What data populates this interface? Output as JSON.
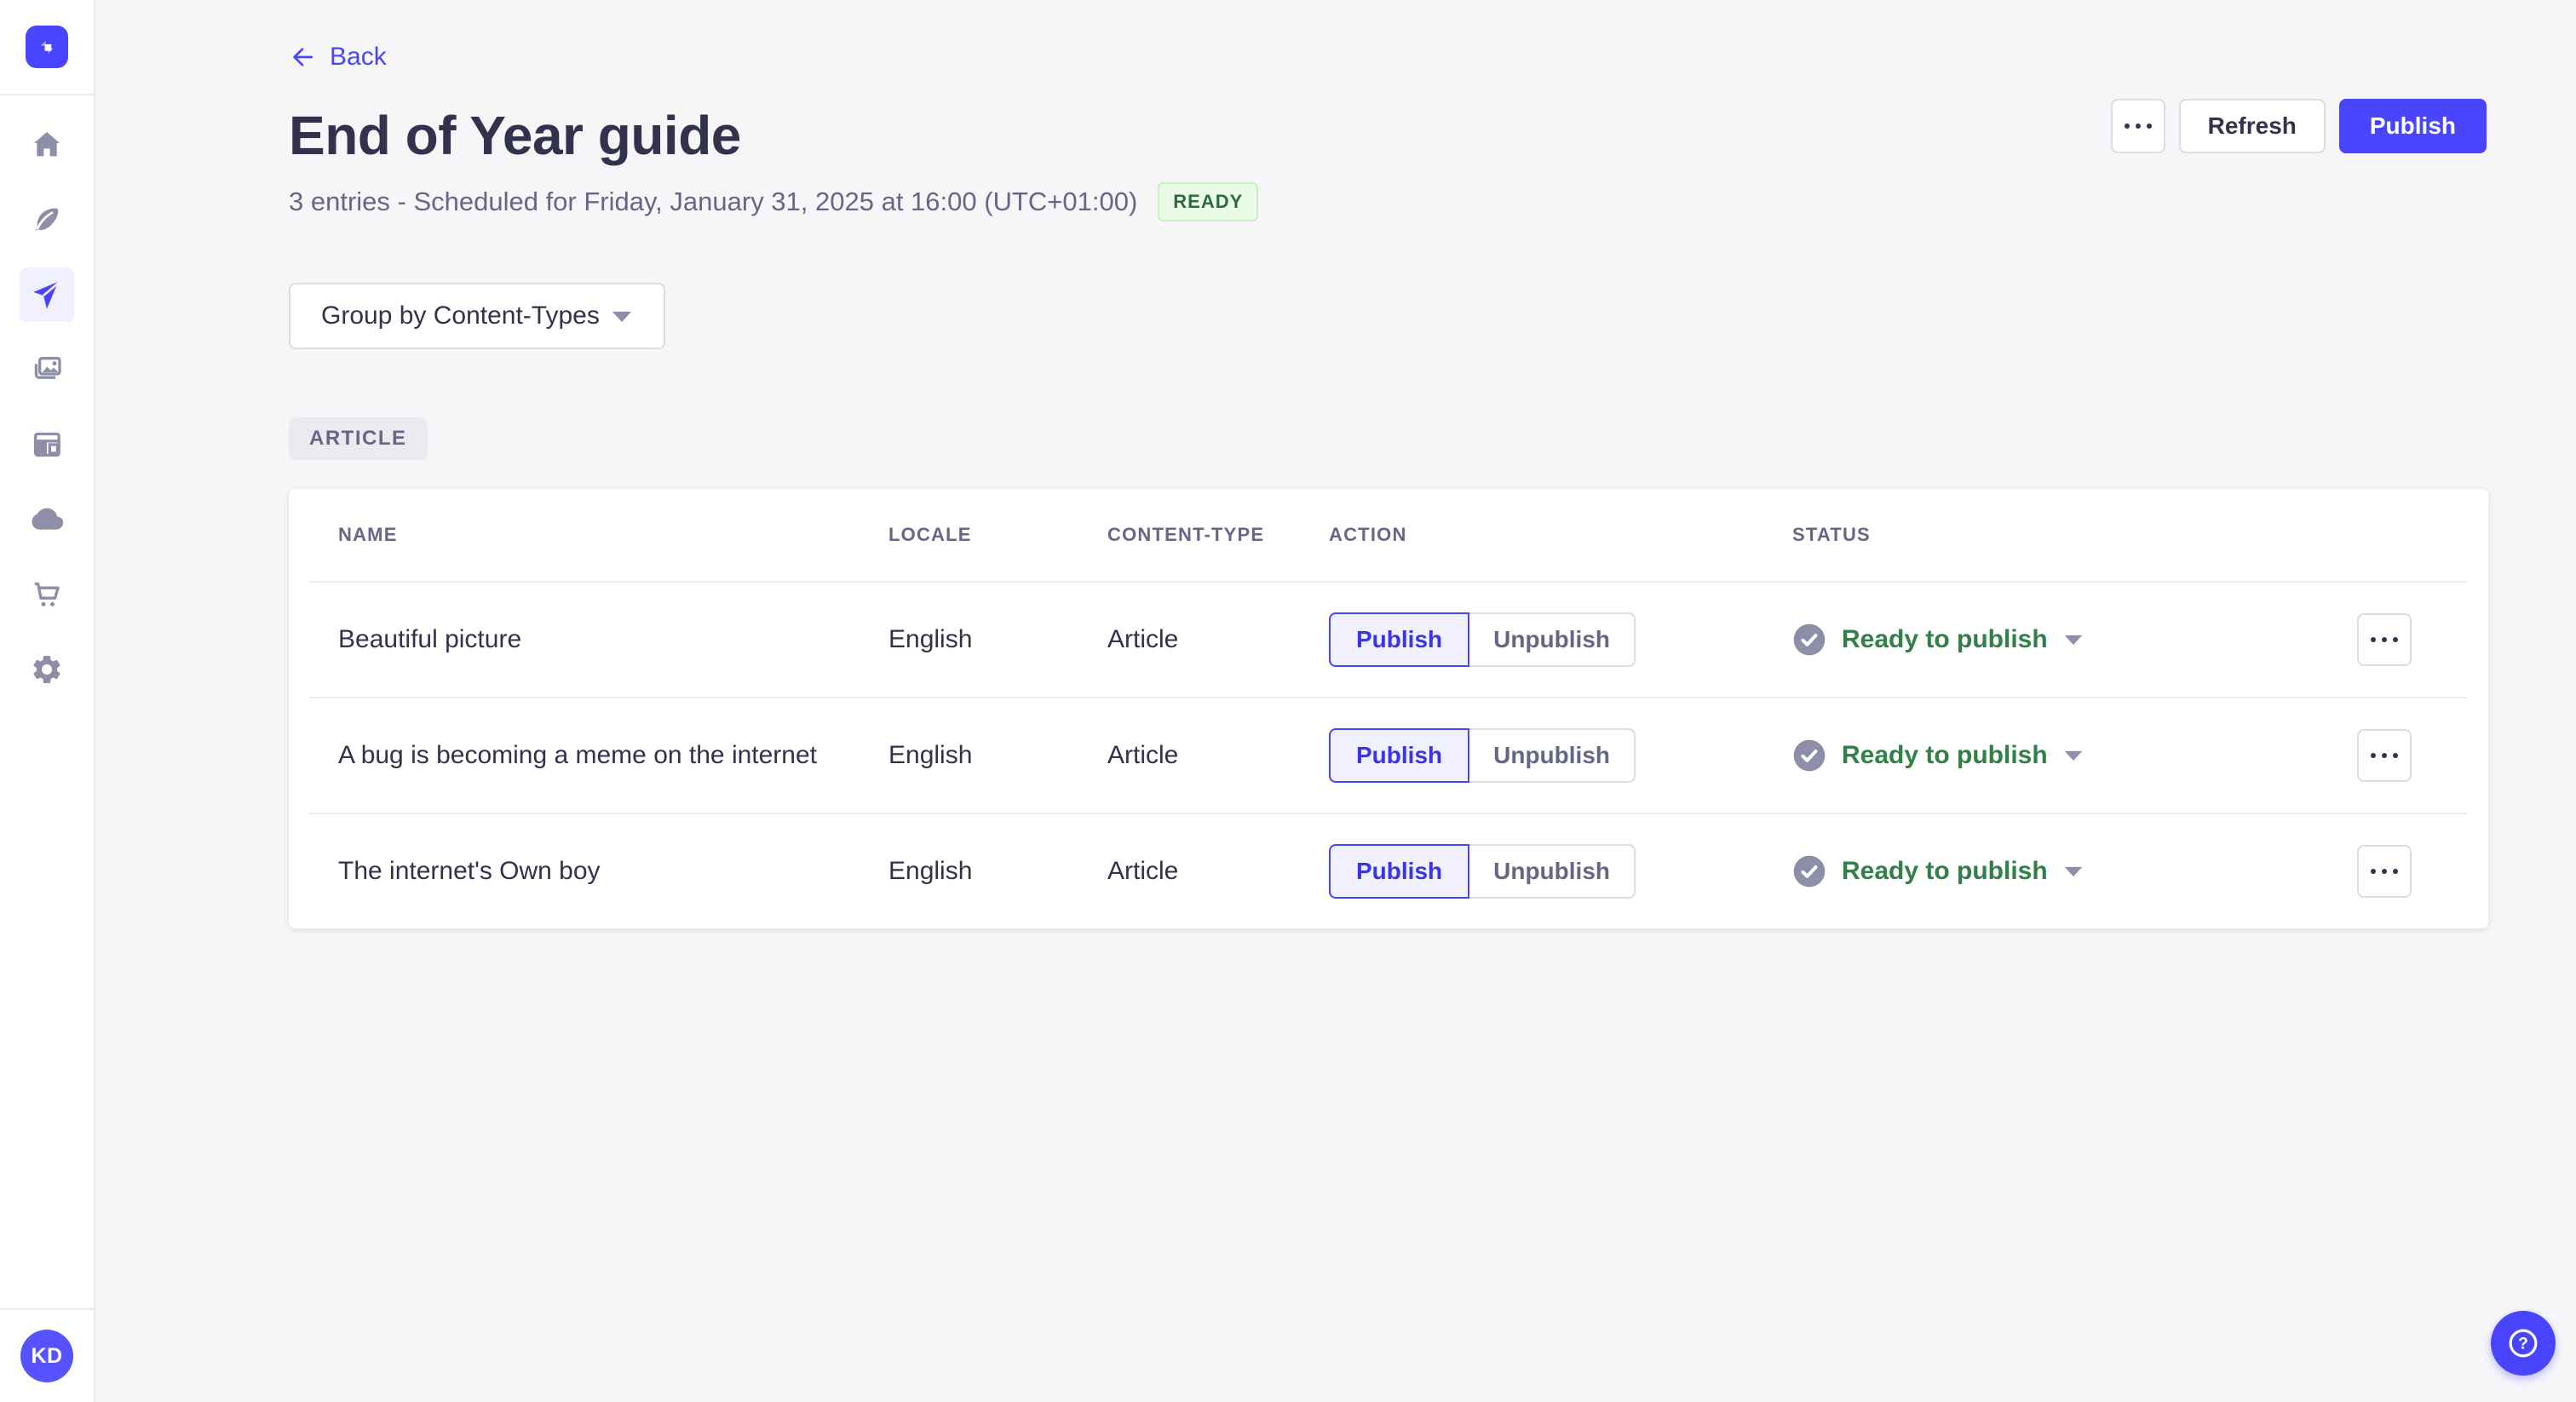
{
  "colors": {
    "primary": "#4945ff",
    "primary_bg": "#f0f0ff",
    "page_bg": "#f6f6f9",
    "text_dark": "#32324d",
    "text_muted": "#666687",
    "border": "#dcdce4",
    "divider": "#eaeaef",
    "success_text": "#2f6846",
    "success_bg": "#eafbe7",
    "status_green": "#328048",
    "icon_gray": "#8e8ea9"
  },
  "sidebar": {
    "logo_icon": "strapi-logo",
    "items": [
      {
        "icon": "home-icon",
        "active": false
      },
      {
        "icon": "feather-icon",
        "active": false
      },
      {
        "icon": "paper-plane-icon",
        "active": true
      },
      {
        "icon": "media-library-icon",
        "active": false
      },
      {
        "icon": "layout-icon",
        "active": false
      },
      {
        "icon": "cloud-icon",
        "active": false
      },
      {
        "icon": "cart-icon",
        "active": false
      },
      {
        "icon": "gear-icon",
        "active": false
      }
    ],
    "avatar_initials": "KD"
  },
  "header": {
    "back_label": "Back",
    "title": "End of Year guide",
    "subtitle": "3 entries - Scheduled for Friday, January 31, 2025 at 16:00 (UTC+01:00)",
    "status_badge": "READY",
    "refresh_label": "Refresh",
    "publish_label": "Publish"
  },
  "controls": {
    "group_by_label": "Group by Content-Types"
  },
  "group_label": "ARTICLE",
  "table": {
    "headers": {
      "name": "NAME",
      "locale": "LOCALE",
      "content_type": "CONTENT-TYPE",
      "action": "ACTION",
      "status": "STATUS"
    },
    "actions": {
      "publish": "Publish",
      "unpublish": "Unpublish"
    },
    "rows": [
      {
        "name": "Beautiful picture",
        "locale": "English",
        "content_type": "Article",
        "status": "Ready to publish"
      },
      {
        "name": "A bug is becoming a meme on the internet",
        "locale": "English",
        "content_type": "Article",
        "status": "Ready to publish"
      },
      {
        "name": "The internet's Own boy",
        "locale": "English",
        "content_type": "Article",
        "status": "Ready to publish"
      }
    ]
  },
  "help": {
    "glyph": "?"
  }
}
